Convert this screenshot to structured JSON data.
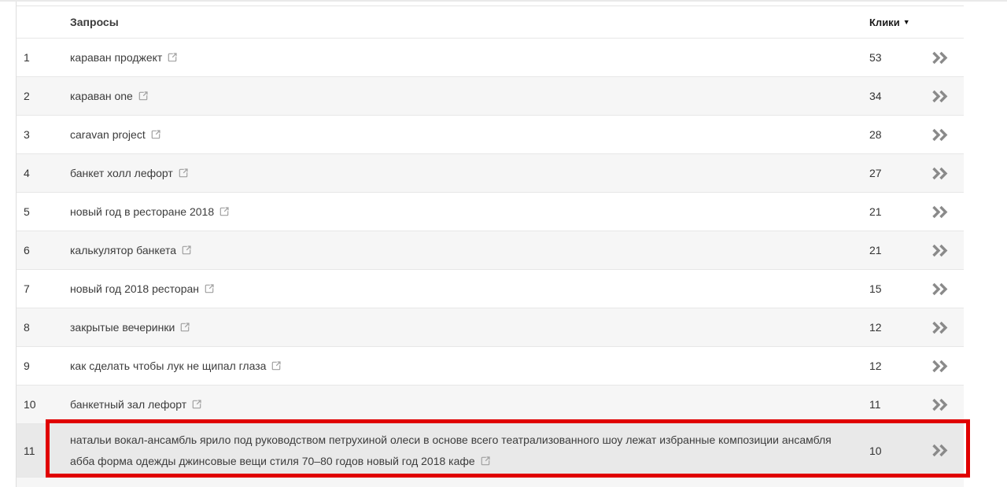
{
  "table": {
    "header": {
      "query": "Запросы",
      "clicks": "Клики",
      "sort_icon": "▼",
      "sort_direction": "descending"
    },
    "rows": [
      {
        "index": "1",
        "query": "караван проджект",
        "clicks": "53",
        "highlighted": false
      },
      {
        "index": "2",
        "query": "караван one",
        "clicks": "34",
        "highlighted": false
      },
      {
        "index": "3",
        "query": "caravan project",
        "clicks": "28",
        "highlighted": false
      },
      {
        "index": "4",
        "query": "банкет холл лефорт",
        "clicks": "27",
        "highlighted": false
      },
      {
        "index": "5",
        "query": "новый год в ресторане 2018",
        "clicks": "21",
        "highlighted": false
      },
      {
        "index": "6",
        "query": "калькулятор банкета",
        "clicks": "21",
        "highlighted": false
      },
      {
        "index": "7",
        "query": "новый год 2018 ресторан",
        "clicks": "15",
        "highlighted": false
      },
      {
        "index": "8",
        "query": "закрытые вечеринки",
        "clicks": "12",
        "highlighted": false
      },
      {
        "index": "9",
        "query": "как сделать чтобы лук не щипал глаза",
        "clicks": "12",
        "highlighted": false
      },
      {
        "index": "10",
        "query": "банкетный зал лефорт",
        "clicks": "11",
        "highlighted": false
      },
      {
        "index": "11",
        "query": "натальи вокал-ансамбль ярило под руководством петрухиной олеси в основе всего театрализованного шоу лежат избранные композиции ансамбля абба форма одежды джинсовые вещи стиля 70–80 годов новый год 2018 кафе",
        "clicks": "10",
        "highlighted": true
      }
    ],
    "icons": {
      "external_link": "external-link-icon",
      "expand": "double-chevron-right-icon"
    },
    "colors": {
      "highlight_border": "#e00000",
      "highlight_row_bg": "#e9e9e9",
      "row_stripe_bg": "#f6f6f6",
      "chevron": "#8a8a8a",
      "link_icon": "#a0a0a0"
    }
  }
}
